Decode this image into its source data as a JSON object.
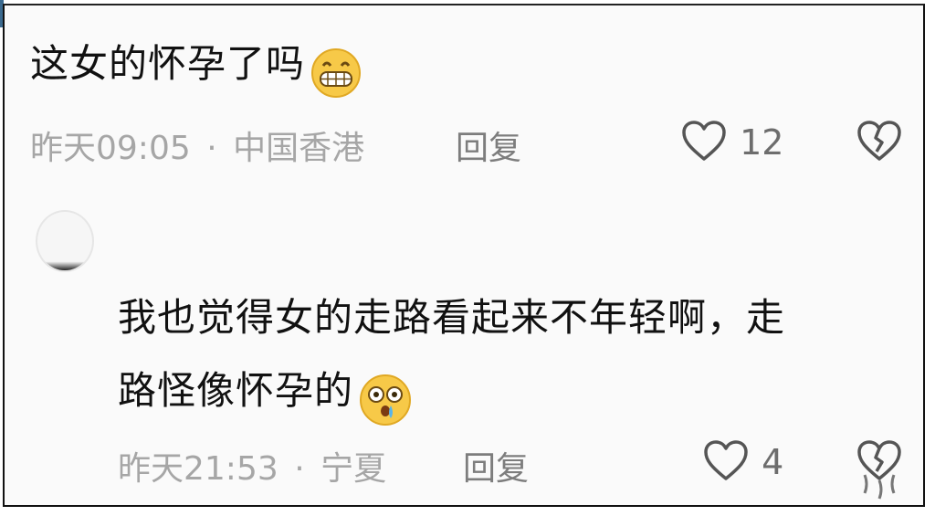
{
  "comments": [
    {
      "text": "这女的怀孕了吗",
      "emoji": "grinning-face-emoji",
      "time": "昨天09:05",
      "separator": "·",
      "location": "中国香港",
      "reply_label": "回复",
      "likes": "12",
      "like_icon": "heart-outline-icon",
      "dislike_icon": "broken-heart-icon"
    },
    {
      "text_line1": "我也觉得女的走路看起来不年轻啊，走",
      "text_line2": "路怪像怀孕的",
      "emoji": "astonished-face-emoji",
      "time": "昨天21:53",
      "separator": "·",
      "location": "宁夏",
      "reply_label": "回复",
      "likes": "4",
      "like_icon": "heart-outline-icon",
      "dislike_icon": "broken-heart-icon"
    }
  ],
  "colors": {
    "text": "#111111",
    "meta": "#a6a6a6",
    "icon": "#555555",
    "emoji_yellow": "#f7c948"
  }
}
